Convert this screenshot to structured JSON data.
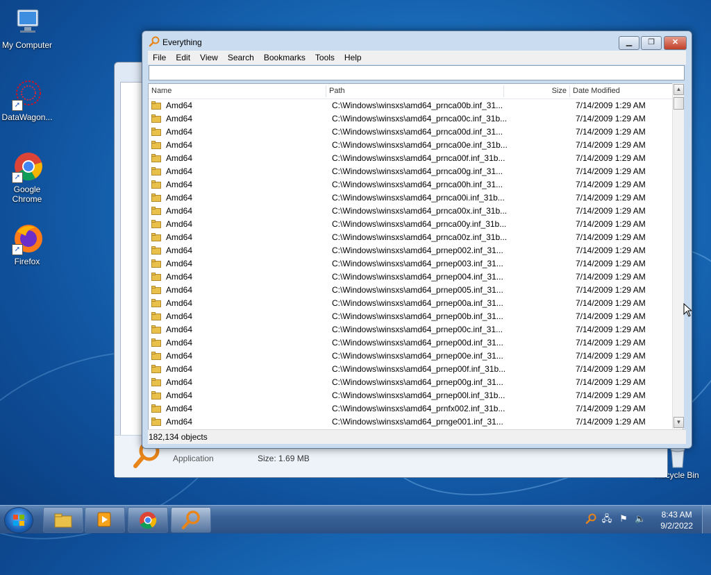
{
  "desktop": {
    "icons": [
      {
        "label": "My Computer"
      },
      {
        "label": "DataWagon..."
      },
      {
        "label": "Google Chrome"
      },
      {
        "label": "Firefox"
      },
      {
        "label": "Recycle Bin"
      }
    ],
    "background_window": {
      "app_type": "Application",
      "size_text": "Size: 1.69 MB"
    }
  },
  "window": {
    "title": "Everything",
    "menu": [
      "File",
      "Edit",
      "View",
      "Search",
      "Bookmarks",
      "Tools",
      "Help"
    ],
    "search": {
      "value": ""
    },
    "columns": {
      "name": "Name",
      "path": "Path",
      "size": "Size",
      "date": "Date Modified"
    },
    "rows": [
      {
        "name": "Amd64",
        "path": "C:\\Windows\\winsxs\\amd64_prnca00b.inf_31...",
        "size": "",
        "date": "7/14/2009 1:29 AM"
      },
      {
        "name": "Amd64",
        "path": "C:\\Windows\\winsxs\\amd64_prnca00c.inf_31b...",
        "size": "",
        "date": "7/14/2009 1:29 AM"
      },
      {
        "name": "Amd64",
        "path": "C:\\Windows\\winsxs\\amd64_prnca00d.inf_31...",
        "size": "",
        "date": "7/14/2009 1:29 AM"
      },
      {
        "name": "Amd64",
        "path": "C:\\Windows\\winsxs\\amd64_prnca00e.inf_31b...",
        "size": "",
        "date": "7/14/2009 1:29 AM"
      },
      {
        "name": "Amd64",
        "path": "C:\\Windows\\winsxs\\amd64_prnca00f.inf_31b...",
        "size": "",
        "date": "7/14/2009 1:29 AM"
      },
      {
        "name": "Amd64",
        "path": "C:\\Windows\\winsxs\\amd64_prnca00g.inf_31...",
        "size": "",
        "date": "7/14/2009 1:29 AM"
      },
      {
        "name": "Amd64",
        "path": "C:\\Windows\\winsxs\\amd64_prnca00h.inf_31...",
        "size": "",
        "date": "7/14/2009 1:29 AM"
      },
      {
        "name": "Amd64",
        "path": "C:\\Windows\\winsxs\\amd64_prnca00i.inf_31b...",
        "size": "",
        "date": "7/14/2009 1:29 AM"
      },
      {
        "name": "Amd64",
        "path": "C:\\Windows\\winsxs\\amd64_prnca00x.inf_31b...",
        "size": "",
        "date": "7/14/2009 1:29 AM"
      },
      {
        "name": "Amd64",
        "path": "C:\\Windows\\winsxs\\amd64_prnca00y.inf_31b...",
        "size": "",
        "date": "7/14/2009 1:29 AM"
      },
      {
        "name": "Amd64",
        "path": "C:\\Windows\\winsxs\\amd64_prnca00z.inf_31b...",
        "size": "",
        "date": "7/14/2009 1:29 AM"
      },
      {
        "name": "Amd64",
        "path": "C:\\Windows\\winsxs\\amd64_prnep002.inf_31...",
        "size": "",
        "date": "7/14/2009 1:29 AM"
      },
      {
        "name": "Amd64",
        "path": "C:\\Windows\\winsxs\\amd64_prnep003.inf_31...",
        "size": "",
        "date": "7/14/2009 1:29 AM"
      },
      {
        "name": "Amd64",
        "path": "C:\\Windows\\winsxs\\amd64_prnep004.inf_31...",
        "size": "",
        "date": "7/14/2009 1:29 AM"
      },
      {
        "name": "Amd64",
        "path": "C:\\Windows\\winsxs\\amd64_prnep005.inf_31...",
        "size": "",
        "date": "7/14/2009 1:29 AM"
      },
      {
        "name": "Amd64",
        "path": "C:\\Windows\\winsxs\\amd64_prnep00a.inf_31...",
        "size": "",
        "date": "7/14/2009 1:29 AM"
      },
      {
        "name": "Amd64",
        "path": "C:\\Windows\\winsxs\\amd64_prnep00b.inf_31...",
        "size": "",
        "date": "7/14/2009 1:29 AM"
      },
      {
        "name": "Amd64",
        "path": "C:\\Windows\\winsxs\\amd64_prnep00c.inf_31...",
        "size": "",
        "date": "7/14/2009 1:29 AM"
      },
      {
        "name": "Amd64",
        "path": "C:\\Windows\\winsxs\\amd64_prnep00d.inf_31...",
        "size": "",
        "date": "7/14/2009 1:29 AM"
      },
      {
        "name": "Amd64",
        "path": "C:\\Windows\\winsxs\\amd64_prnep00e.inf_31...",
        "size": "",
        "date": "7/14/2009 1:29 AM"
      },
      {
        "name": "Amd64",
        "path": "C:\\Windows\\winsxs\\amd64_prnep00f.inf_31b...",
        "size": "",
        "date": "7/14/2009 1:29 AM"
      },
      {
        "name": "Amd64",
        "path": "C:\\Windows\\winsxs\\amd64_prnep00g.inf_31...",
        "size": "",
        "date": "7/14/2009 1:29 AM"
      },
      {
        "name": "Amd64",
        "path": "C:\\Windows\\winsxs\\amd64_prnep00l.inf_31b...",
        "size": "",
        "date": "7/14/2009 1:29 AM"
      },
      {
        "name": "Amd64",
        "path": "C:\\Windows\\winsxs\\amd64_prnfx002.inf_31b...",
        "size": "",
        "date": "7/14/2009 1:29 AM"
      },
      {
        "name": "Amd64",
        "path": "C:\\Windows\\winsxs\\amd64_prnge001.inf_31...",
        "size": "",
        "date": "7/14/2009 1:29 AM"
      }
    ],
    "status": "182,134 objects"
  },
  "taskbar": {
    "clock_time": "8:43 AM",
    "clock_date": "9/2/2022",
    "items": [
      {
        "icon": "windows-explorer-icon"
      },
      {
        "icon": "media-player-icon"
      },
      {
        "icon": "chrome-icon"
      },
      {
        "icon": "everything-search-icon"
      }
    ]
  },
  "colors": {
    "accent_orange": "#e8851a",
    "folder_yellow": "#e8c04a",
    "titlebar_blue": "#c9dcf0"
  }
}
